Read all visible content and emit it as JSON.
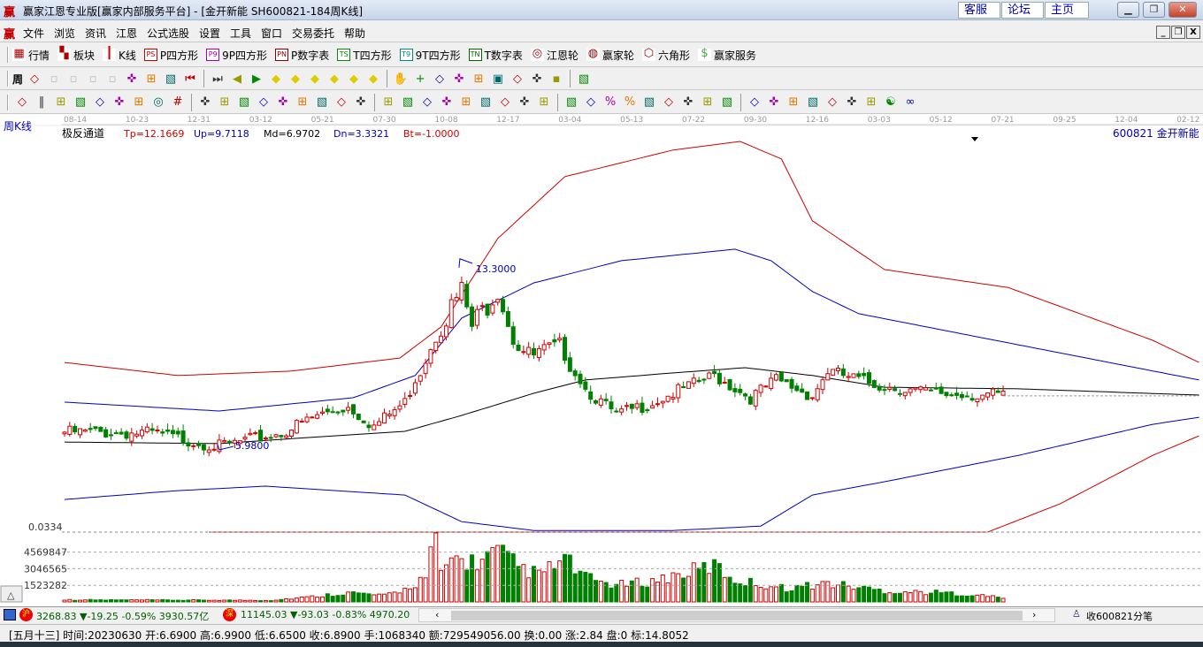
{
  "window": {
    "logo": "赢",
    "title": "赢家江恩专业版[赢家内部服务平台] - [金开新能  SH600821-184周K线]",
    "links": [
      "客服",
      "论坛",
      "主页"
    ],
    "controls": [
      "minimize",
      "restore",
      "close"
    ]
  },
  "menu": {
    "logo": "赢",
    "items": [
      "文件",
      "浏览",
      "资讯",
      "江恩",
      "公式选股",
      "设置",
      "工具",
      "窗口",
      "交易委托",
      "帮助"
    ]
  },
  "toolbar1": [
    {
      "icon": "table-icon",
      "label": "行情"
    },
    {
      "icon": "blocks-icon",
      "label": "板块"
    },
    {
      "icon": "candles-icon",
      "label": "K线"
    },
    {
      "icon": "ps-icon",
      "tag": "PS",
      "label": "P四方形"
    },
    {
      "icon": "p9-icon",
      "tag": "P9",
      "label": "9P四方形"
    },
    {
      "icon": "pn-icon",
      "tag": "PN",
      "label": "P数字表"
    },
    {
      "icon": "ts-icon",
      "tag": "TS",
      "label": "T四方形"
    },
    {
      "icon": "t9-icon",
      "tag": "T9",
      "label": "9T四方形"
    },
    {
      "icon": "tn-icon",
      "tag": "TN",
      "label": "T数字表"
    },
    {
      "icon": "target-icon",
      "label": "江恩轮"
    },
    {
      "icon": "wheel-icon",
      "label": "赢家轮"
    },
    {
      "icon": "hexagon-icon",
      "label": "六角形"
    },
    {
      "icon": "dollar-icon",
      "label": "赢家服务"
    }
  ],
  "toolbar2": {
    "period": "周",
    "icons": [
      "period-dropdown-icon",
      "disabled-icon",
      "disabled-icon",
      "disabled-icon",
      "disabled-icon",
      "candle-type-icon",
      "formula-icon",
      "color-icon",
      "first-icon",
      "last-icon",
      "left-icon",
      "right-icon",
      "zoom-left-icon",
      "zoom-right-icon",
      "zoom-both-icon",
      "shrink-icon",
      "expand-icon",
      "expand-all-icon",
      "hand-icon",
      "crosshair-icon",
      "draw-icon",
      "gann-icon",
      "wheel-icon",
      "calendar-icon",
      "calculator-icon",
      "list-icon",
      "save-icon",
      "print-icon"
    ]
  },
  "toolbar3": {
    "icons": [
      "pen-icon",
      "lines-icon",
      "gold-icon",
      "gold2-icon",
      "f-icon",
      "spiral-icon",
      "brush-icon",
      "circle-icon",
      "hash-icon",
      "n2-icon",
      "angle-icon",
      "cycle-icon",
      "radar-icon",
      "square-icon",
      "parallel-icon",
      "god-icon",
      "win-icon",
      "grid-icon",
      "measure-icon",
      "box-icon",
      "fan-icon",
      "arc-icon",
      "arc2-icon",
      "angle2-icon",
      "v-icon",
      "grid2-icon",
      "grid3-icon",
      "slash-icon",
      "list2-icon",
      "percent-red-icon",
      "percent-icon",
      "percent-line-icon",
      "gold-coin-icon",
      "gold-line-icon",
      "brush2-icon",
      "wave-icon",
      "gold3-icon",
      "j-icon",
      "f2-icon",
      "gold4-icon",
      "god2-icon",
      "win2-icon",
      "four-icon",
      "yinyang-icon",
      "infinity-icon"
    ]
  },
  "chart": {
    "period_label": "周K线",
    "indicator": {
      "name": "极反通道",
      "tp": "Tp=12.1669",
      "up": "Up=9.7118",
      "md": "Md=6.9702",
      "dn": "Dn=3.3321",
      "bt": "Bt=-1.0000"
    },
    "stock": "600821  金开新能",
    "high_label": "13.3000",
    "low_label": "5.9800",
    "sub_label": "0.0334",
    "vol_ticks": [
      "4569847",
      "3046565",
      "1523282"
    ]
  },
  "chart_data": {
    "type": "candlestick",
    "bars": 184,
    "dates": [
      "08-14",
      "10-23",
      "12-31",
      "03-12",
      "05-21",
      "07-30",
      "10-08",
      "12-17",
      "03-04",
      "05-13",
      "07-22",
      "09-30",
      "12-16",
      "03-03",
      "05-12",
      "07-21",
      "09-25",
      "12-04",
      "02-12"
    ],
    "close_path": [
      [
        0,
        6.66
      ],
      [
        17,
        6.62
      ],
      [
        30,
        6.11
      ],
      [
        42,
        6.62
      ],
      [
        49,
        7.3
      ],
      [
        55,
        7.64
      ],
      [
        60,
        6.89
      ],
      [
        66,
        7.8
      ],
      [
        72,
        10.52
      ],
      [
        77,
        12.05
      ],
      [
        79,
        10.69
      ],
      [
        84,
        12.2
      ],
      [
        87,
        10.35
      ],
      [
        90,
        9.5
      ],
      [
        97,
        9.84
      ],
      [
        101,
        8.32
      ],
      [
        107,
        7.3
      ],
      [
        114,
        7.8
      ],
      [
        126,
        8.83
      ],
      [
        133,
        7.98
      ],
      [
        138,
        8.66
      ],
      [
        145,
        8.05
      ],
      [
        148,
        9.0
      ],
      [
        157,
        8.49
      ],
      [
        168,
        8.15
      ],
      [
        183,
        8.05
      ]
    ],
    "high": 13.3,
    "low": 5.98,
    "ylim": [
      2.83,
      17.8
    ],
    "bands": {
      "tp": {
        "color": "#d00000",
        "pts": [
          [
            0,
            9.33
          ],
          [
            22,
            8.83
          ],
          [
            44,
            9.0
          ],
          [
            65,
            9.5
          ],
          [
            73,
            10.69
          ],
          [
            84,
            14.08
          ],
          [
            97,
            16.45
          ],
          [
            118,
            17.47
          ],
          [
            131,
            17.8
          ],
          [
            139,
            17.13
          ],
          [
            145,
            14.76
          ],
          [
            159,
            12.89
          ],
          [
            183,
            12.2
          ],
          [
            211,
            10.18
          ],
          [
            220,
            9.33
          ]
        ]
      },
      "up": {
        "color": "#0000c0",
        "pts": [
          [
            0,
            7.81
          ],
          [
            30,
            7.47
          ],
          [
            56,
            7.98
          ],
          [
            68,
            8.83
          ],
          [
            77,
            11.03
          ],
          [
            91,
            12.38
          ],
          [
            108,
            13.23
          ],
          [
            130,
            13.67
          ],
          [
            137,
            13.23
          ],
          [
            145,
            12.05
          ],
          [
            154,
            11.2
          ],
          [
            176,
            10.35
          ],
          [
            220,
            8.66
          ]
        ]
      },
      "md": {
        "color": "#000000",
        "pts": [
          [
            0,
            6.28
          ],
          [
            30,
            6.22
          ],
          [
            47,
            6.45
          ],
          [
            66,
            6.69
          ],
          [
            77,
            7.3
          ],
          [
            91,
            8.15
          ],
          [
            101,
            8.66
          ],
          [
            118,
            8.93
          ],
          [
            132,
            9.13
          ],
          [
            145,
            8.83
          ],
          [
            159,
            8.38
          ],
          [
            185,
            8.32
          ],
          [
            220,
            8.08
          ]
        ]
      },
      "dn": {
        "color": "#0000c0",
        "pts": [
          [
            0,
            4.08
          ],
          [
            22,
            4.42
          ],
          [
            39,
            4.59
          ],
          [
            66,
            4.25
          ],
          [
            77,
            3.23
          ],
          [
            91,
            2.89
          ],
          [
            118,
            2.89
          ],
          [
            135,
            3.06
          ],
          [
            145,
            4.25
          ],
          [
            159,
            4.76
          ],
          [
            185,
            5.77
          ],
          [
            211,
            6.96
          ],
          [
            220,
            7.23
          ]
        ]
      },
      "bt": {
        "color": "#d00000",
        "pts": [
          [
            28,
            2.83
          ],
          [
            179,
            2.83
          ],
          [
            193,
            3.91
          ],
          [
            211,
            5.77
          ],
          [
            220,
            6.52
          ]
        ]
      }
    },
    "volume": {
      "max": 6300000,
      "path": [
        [
          0,
          200000
        ],
        [
          40,
          150000
        ],
        [
          48,
          500000
        ],
        [
          55,
          900000
        ],
        [
          62,
          600000
        ],
        [
          66,
          1200000
        ],
        [
          70,
          2400000
        ],
        [
          72,
          6300000
        ],
        [
          73,
          2500000
        ],
        [
          75,
          4200000
        ],
        [
          80,
          3800000
        ],
        [
          84,
          4800000
        ],
        [
          88,
          3400000
        ],
        [
          92,
          2600000
        ],
        [
          97,
          4100000
        ],
        [
          101,
          2300000
        ],
        [
          107,
          1600000
        ],
        [
          114,
          2000000
        ],
        [
          126,
          3500000
        ],
        [
          130,
          2100000
        ],
        [
          140,
          1300000
        ],
        [
          148,
          1800000
        ],
        [
          160,
          1000000
        ],
        [
          170,
          900000
        ],
        [
          183,
          400000
        ]
      ]
    }
  },
  "status": {
    "sh_badge": "沪",
    "sh": "3268.83 ▼-19.25 -0.59% 3930.57亿",
    "sz_badge": "深",
    "sz": "11145.03 ▼-93.03 -0.83% 4970.20",
    "tick": "收600821分笔"
  },
  "bar_info": "[五月十三] 时间:20230630 开:6.6900 高:6.9900 低:6.6500 收:6.8900 手:1068340 额:729549056.00 换:0.00 涨:2.84 盘:0 标:14.8052"
}
